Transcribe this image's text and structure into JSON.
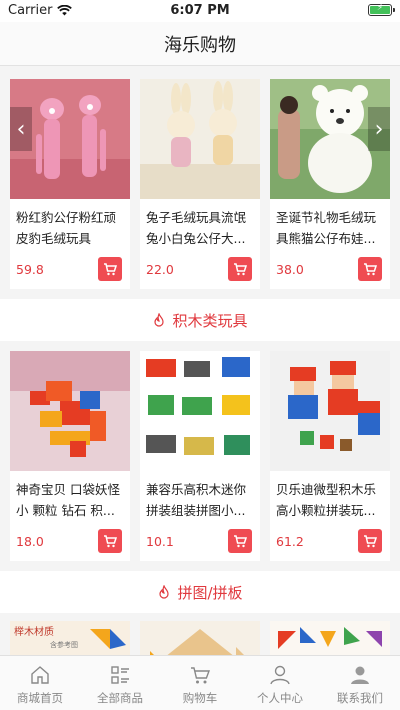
{
  "status_bar": {
    "carrier": "Carrier",
    "time": "6:07 PM"
  },
  "nav": {
    "title": "海乐购物"
  },
  "featured": {
    "items": [
      {
        "name": "粉红豹公仔粉红顽皮豹毛绒玩具",
        "price": "59.8"
      },
      {
        "name": "兔子毛绒玩具流氓兔小白兔公仔大...",
        "price": "22.0"
      },
      {
        "name": "圣诞节礼物毛绒玩具熊猫公仔布娃...",
        "price": "38.0"
      }
    ]
  },
  "sections": [
    {
      "title": "积木类玩具",
      "items": [
        {
          "name": "神奇宝贝 口袋妖怪 小 颗粒 钻石 积...",
          "price": "18.0"
        },
        {
          "name": "兼容乐高积木迷你拼装组装拼图小...",
          "price": "10.1"
        },
        {
          "name": "贝乐迪微型积木乐高小颗粒拼装玩...",
          "price": "61.2"
        }
      ]
    },
    {
      "title": "拼图/拼板",
      "items": [
        {
          "name": "",
          "price": ""
        },
        {
          "name": "",
          "price": ""
        },
        {
          "name": "",
          "price": ""
        }
      ]
    }
  ],
  "partial_image_text": {
    "wood": "榉木材质",
    "note": "含参考图"
  },
  "tabs": [
    {
      "label": "商城首页",
      "icon": "home-icon"
    },
    {
      "label": "全部商品",
      "icon": "list-icon"
    },
    {
      "label": "购物车",
      "icon": "cart-icon"
    },
    {
      "label": "个人中心",
      "icon": "user-icon"
    },
    {
      "label": "联系我们",
      "icon": "contact-icon"
    }
  ],
  "colors": {
    "accent": "#e0393e",
    "cart_button": "#ef4b52",
    "battery": "#43c15a"
  }
}
